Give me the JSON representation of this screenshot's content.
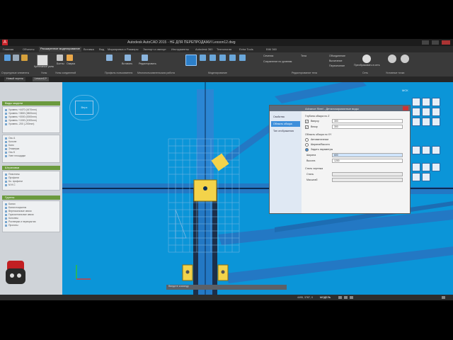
{
  "app": {
    "title": "Autodesk AutoCAD 2015 - НЕ ДЛЯ ПЕРЕПРОДАЖИ   Lesson12.dwg"
  },
  "ribbon": {
    "tabs": [
      "Главная",
      "Объекты",
      "Расширенное моделирование",
      "Вставка",
      "Вид",
      "Маркировка и Размеры",
      "Экспорт и импорт",
      "Инструменты",
      "Autodesk 360",
      "Технология",
      "Extra Tools",
      "BIM 360"
    ],
    "active_tab": 2,
    "panels": [
      "Структурные элементы",
      "Узлы",
      "Узлы соединений",
      "Профиль пользователя",
      "Многопользовательская работа",
      "Моделирование",
      "Редактирование тела",
      "Сеть",
      "Условные точки"
    ],
    "buttons": {
      "wall": "Крепежные узлы",
      "bolts": "Болты",
      "weld": "Сварка",
      "insert": "Вставить",
      "edit": "Редактировать",
      "sections": "Сечения",
      "solids": "Тела",
      "merge": "Объединение",
      "subtract": "Вычитание",
      "intersect": "Пересечение",
      "save": "Сохранение по уровням",
      "convert": "Преобразовать в сеть"
    }
  },
  "doc_tabs": [
    "Новый чертеж",
    "Lesson12*"
  ],
  "left_panel": {
    "sections": [
      {
        "title": "Виды модели",
        "items": [
          "Уровень +4470 (4470mm)",
          "Уровень +3800 (3800mm)",
          "Уровень +0000 (0000mm)",
          "Уровень +1000 (1000mm)",
          "Уровень -200 (-200mm)"
        ]
      },
      {
        "title": "",
        "items": [
          "Ось А",
          "Колонн",
          "Балк",
          "Этажерка",
          "Ось Б",
          "Узел площадки"
        ]
      },
      {
        "title": "Штриховки",
        "items": [
          "Пластины",
          "Профили",
          "Ко. профили",
          "М.Н.С"
        ]
      },
      {
        "title": "Группы",
        "items": [
          "Балки",
          "Балки покрытия",
          "Вертикальные связи",
          "Горизонтальные связи",
          "Колонны",
          "Ростверки и перекрытия",
          "Прогоны"
        ]
      }
    ]
  },
  "dialog": {
    "title": "Advance Steel - Детализированные виды",
    "side_items": [
      "Свойства",
      "Область обзора",
      "Тип отображения"
    ],
    "active_side": 1,
    "group_depth": "Глубина обзора по Z",
    "cb_top": "Вверху",
    "cb_bottom": "Внизу",
    "val_top": "300",
    "val_bottom": "300",
    "group_area": "Область обзора по XY",
    "opt_auto": "Автоматически",
    "opt_size": "Ширина/Высота",
    "opt_param": "Задать параметры",
    "lbl_width": "Ширина",
    "lbl_height": "Высота",
    "val_width": "600",
    "val_height": "1200",
    "group_scale": "Стиль чертежа",
    "lbl_style": "Стиль",
    "lbl_scale": "Масштаб"
  },
  "canvas": {
    "viewcube_label": "Верх",
    "wcs_label": "МСК",
    "ucs": "Y"
  },
  "command_placeholder": "Введите команду",
  "status": {
    "coords": "4495, 3787, 0",
    "mode": "МОДЕЛЬ"
  },
  "colors": {
    "canvas_bg": "#0b95d8",
    "beam": "#1f7fc8",
    "accent_green": "#6b9a3e",
    "plate": "#f3d34a"
  }
}
